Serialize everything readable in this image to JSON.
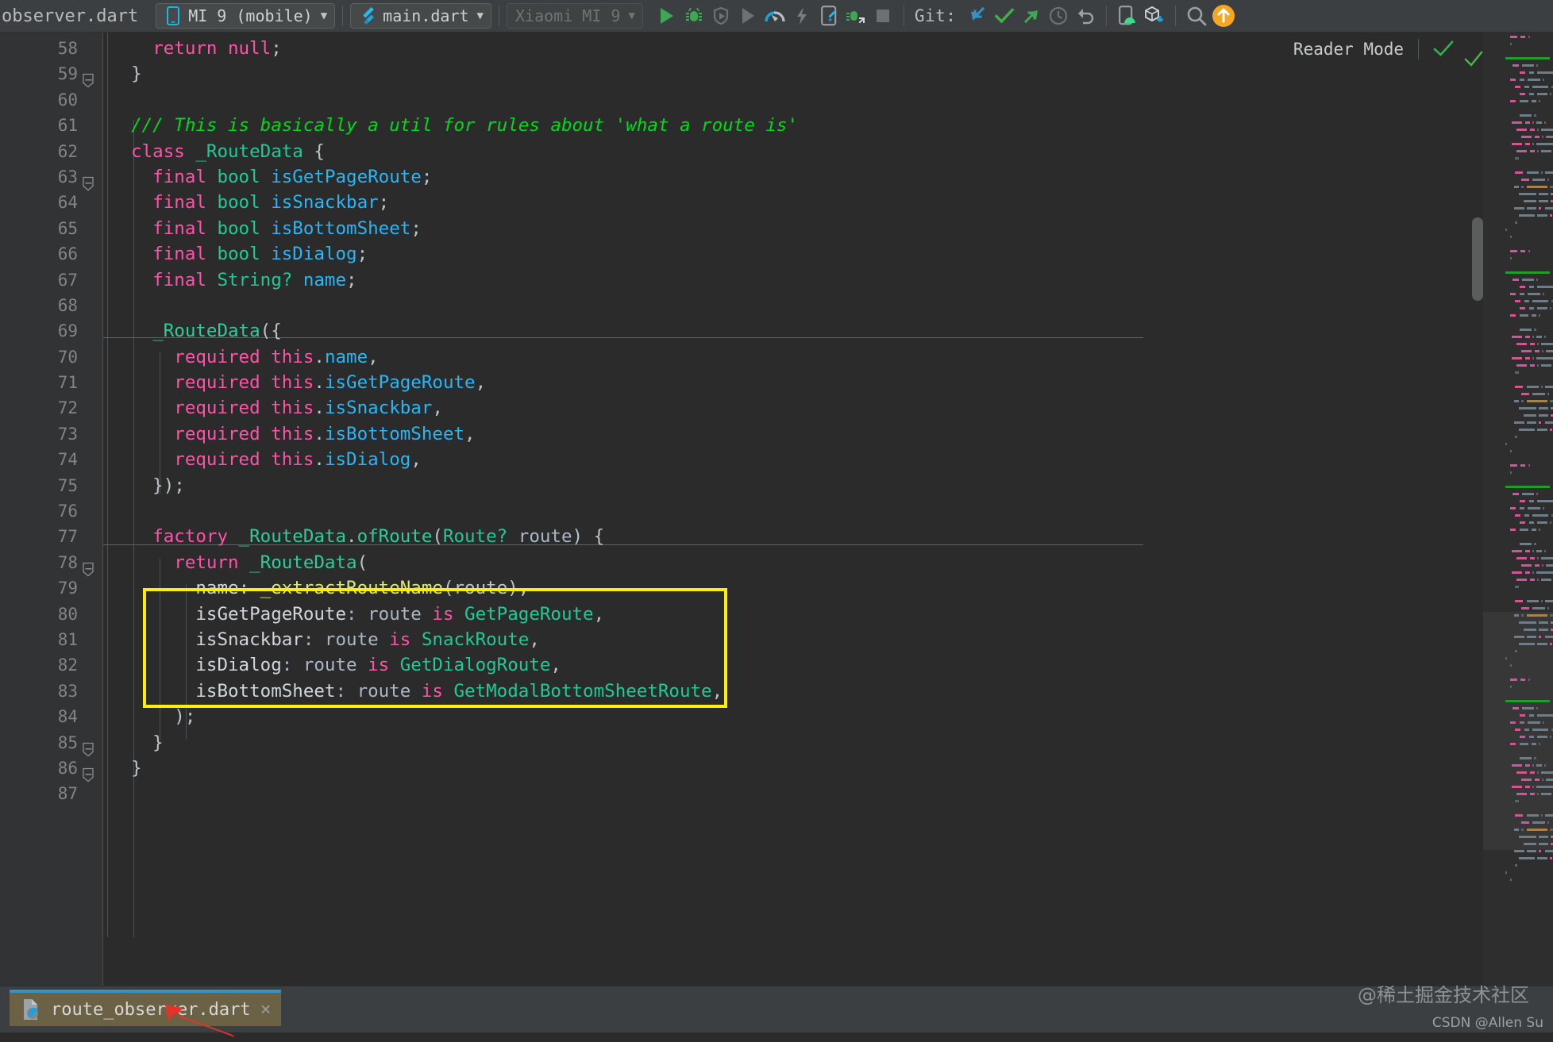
{
  "toolbar": {
    "filename": "observer.dart",
    "device_selector": {
      "label": "MI 9 (mobile)",
      "icon": "phone-icon",
      "caret": "▼"
    },
    "run_config": {
      "label": "main.dart",
      "icon": "flutter-icon",
      "caret": "▼"
    },
    "target_device": {
      "label": "Xiaomi MI 9",
      "caret": "▼"
    },
    "git_label": "Git:",
    "actions": [
      {
        "name": "run-button",
        "icon": "play-icon",
        "color": "#3ea754"
      },
      {
        "name": "debug-button",
        "icon": "bug-icon",
        "color": "#3ea754"
      },
      {
        "name": "run-with-coverage-button",
        "icon": "shield-play-icon",
        "color": "#6e7174"
      },
      {
        "name": "profile-run-button",
        "icon": "play-outline-icon",
        "color": "#6e7174"
      },
      {
        "name": "flutter-performance-button",
        "icon": "speedometer-icon",
        "color": "#19a3d8"
      },
      {
        "name": "hot-reload-button",
        "icon": "lightning-icon",
        "color": "#787c7f"
      },
      {
        "name": "open-devtools-button",
        "icon": "device-flutter-icon",
        "color": "#9aa0a4"
      },
      {
        "name": "attach-debugger-button",
        "icon": "debug-attach-icon",
        "color": "#3ea754"
      },
      {
        "name": "stop-button",
        "icon": "stop-square-icon",
        "color": "#6e7174"
      },
      {
        "name": "git-update-project-button",
        "icon": "arrow-down-left-icon",
        "color": "#3592c4"
      },
      {
        "name": "git-commit-button",
        "icon": "check-icon",
        "color": "#42b047"
      },
      {
        "name": "git-push-button",
        "icon": "arrow-up-right-icon",
        "color": "#3ea754"
      },
      {
        "name": "git-history-button",
        "icon": "clock-icon",
        "color": "#6e7174"
      },
      {
        "name": "git-rollback-button",
        "icon": "undo-icon",
        "color": "#9aa0a4"
      },
      {
        "name": "avd-manager-button",
        "icon": "device-android-icon",
        "color": "#3ddc84"
      },
      {
        "name": "sdk-manager-button",
        "icon": "cube-download-icon",
        "color": "#1f9ed1"
      },
      {
        "name": "search-everywhere-button",
        "icon": "search-icon",
        "color": "#9aa0a4"
      },
      {
        "name": "notifications-button",
        "icon": "arrow-up-circle-icon",
        "color": "#f5a623"
      }
    ]
  },
  "reader_mode": {
    "label": "Reader Mode",
    "icon": "check-icon",
    "color": "#2eb34a"
  },
  "editor": {
    "first_line_number": 58,
    "lines": [
      {
        "n": 58,
        "tokens": [
          {
            "t": "    ",
            "c": "plain"
          },
          {
            "t": "return",
            "c": "k"
          },
          {
            "t": " ",
            "c": "plain"
          },
          {
            "t": "null",
            "c": "k"
          },
          {
            "t": ";",
            "c": "pn"
          }
        ]
      },
      {
        "n": 59,
        "tokens": [
          {
            "t": "  }",
            "c": "pn"
          }
        ]
      },
      {
        "n": 60,
        "tokens": []
      },
      {
        "n": 61,
        "tokens": [
          {
            "t": "  /// This is basically a util for rules about 'what a route is'",
            "c": "cm"
          }
        ]
      },
      {
        "n": 62,
        "tokens": [
          {
            "t": "  ",
            "c": "plain"
          },
          {
            "t": "class",
            "c": "k"
          },
          {
            "t": " ",
            "c": "plain"
          },
          {
            "t": "_RouteData",
            "c": "ty"
          },
          {
            "t": " {",
            "c": "pn"
          }
        ]
      },
      {
        "n": 63,
        "tokens": [
          {
            "t": "    ",
            "c": "plain"
          },
          {
            "t": "final",
            "c": "k"
          },
          {
            "t": " ",
            "c": "plain"
          },
          {
            "t": "bool",
            "c": "ty"
          },
          {
            "t": " ",
            "c": "plain"
          },
          {
            "t": "isGetPageRoute",
            "c": "id"
          },
          {
            "t": ";",
            "c": "pn"
          }
        ]
      },
      {
        "n": 64,
        "tokens": [
          {
            "t": "    ",
            "c": "plain"
          },
          {
            "t": "final",
            "c": "k"
          },
          {
            "t": " ",
            "c": "plain"
          },
          {
            "t": "bool",
            "c": "ty"
          },
          {
            "t": " ",
            "c": "plain"
          },
          {
            "t": "isSnackbar",
            "c": "id"
          },
          {
            "t": ";",
            "c": "pn"
          }
        ]
      },
      {
        "n": 65,
        "tokens": [
          {
            "t": "    ",
            "c": "plain"
          },
          {
            "t": "final",
            "c": "k"
          },
          {
            "t": " ",
            "c": "plain"
          },
          {
            "t": "bool",
            "c": "ty"
          },
          {
            "t": " ",
            "c": "plain"
          },
          {
            "t": "isBottomSheet",
            "c": "id"
          },
          {
            "t": ";",
            "c": "pn"
          }
        ]
      },
      {
        "n": 66,
        "tokens": [
          {
            "t": "    ",
            "c": "plain"
          },
          {
            "t": "final",
            "c": "k"
          },
          {
            "t": " ",
            "c": "plain"
          },
          {
            "t": "bool",
            "c": "ty"
          },
          {
            "t": " ",
            "c": "plain"
          },
          {
            "t": "isDialog",
            "c": "id"
          },
          {
            "t": ";",
            "c": "pn"
          }
        ]
      },
      {
        "n": 67,
        "tokens": [
          {
            "t": "    ",
            "c": "plain"
          },
          {
            "t": "final",
            "c": "k"
          },
          {
            "t": " ",
            "c": "plain"
          },
          {
            "t": "String?",
            "c": "ty"
          },
          {
            "t": " ",
            "c": "plain"
          },
          {
            "t": "name",
            "c": "id"
          },
          {
            "t": ";",
            "c": "pn"
          }
        ]
      },
      {
        "n": 68,
        "tokens": []
      },
      {
        "n": 69,
        "tokens": [
          {
            "t": "    ",
            "c": "plain"
          },
          {
            "t": "_RouteData",
            "c": "ty2"
          },
          {
            "t": "({",
            "c": "pn"
          }
        ]
      },
      {
        "n": 70,
        "tokens": [
          {
            "t": "      ",
            "c": "plain"
          },
          {
            "t": "required",
            "c": "k"
          },
          {
            "t": " ",
            "c": "plain"
          },
          {
            "t": "this",
            "c": "k"
          },
          {
            "t": ".",
            "c": "pn"
          },
          {
            "t": "name",
            "c": "id"
          },
          {
            "t": ",",
            "c": "pn"
          }
        ]
      },
      {
        "n": 71,
        "tokens": [
          {
            "t": "      ",
            "c": "plain"
          },
          {
            "t": "required",
            "c": "k"
          },
          {
            "t": " ",
            "c": "plain"
          },
          {
            "t": "this",
            "c": "k"
          },
          {
            "t": ".",
            "c": "pn"
          },
          {
            "t": "isGetPageRoute",
            "c": "id"
          },
          {
            "t": ",",
            "c": "pn"
          }
        ]
      },
      {
        "n": 72,
        "tokens": [
          {
            "t": "      ",
            "c": "plain"
          },
          {
            "t": "required",
            "c": "k"
          },
          {
            "t": " ",
            "c": "plain"
          },
          {
            "t": "this",
            "c": "k"
          },
          {
            "t": ".",
            "c": "pn"
          },
          {
            "t": "isSnackbar",
            "c": "id"
          },
          {
            "t": ",",
            "c": "pn"
          }
        ]
      },
      {
        "n": 73,
        "tokens": [
          {
            "t": "      ",
            "c": "plain"
          },
          {
            "t": "required",
            "c": "k"
          },
          {
            "t": " ",
            "c": "plain"
          },
          {
            "t": "this",
            "c": "k"
          },
          {
            "t": ".",
            "c": "pn"
          },
          {
            "t": "isBottomSheet",
            "c": "id"
          },
          {
            "t": ",",
            "c": "pn"
          }
        ]
      },
      {
        "n": 74,
        "tokens": [
          {
            "t": "      ",
            "c": "plain"
          },
          {
            "t": "required",
            "c": "k"
          },
          {
            "t": " ",
            "c": "plain"
          },
          {
            "t": "this",
            "c": "k"
          },
          {
            "t": ".",
            "c": "pn"
          },
          {
            "t": "isDialog",
            "c": "id"
          },
          {
            "t": ",",
            "c": "pn"
          }
        ]
      },
      {
        "n": 75,
        "tokens": [
          {
            "t": "    });",
            "c": "pn"
          }
        ]
      },
      {
        "n": 76,
        "tokens": []
      },
      {
        "n": 77,
        "tokens": [
          {
            "t": "    ",
            "c": "plain"
          },
          {
            "t": "factory",
            "c": "k"
          },
          {
            "t": " ",
            "c": "plain"
          },
          {
            "t": "_RouteData",
            "c": "ty2"
          },
          {
            "t": ".",
            "c": "pn"
          },
          {
            "t": "ofRoute",
            "c": "ty2"
          },
          {
            "t": "(",
            "c": "pn"
          },
          {
            "t": "Route?",
            "c": "ty"
          },
          {
            "t": " route",
            "c": "plain"
          },
          {
            "t": ") {",
            "c": "pn"
          }
        ]
      },
      {
        "n": 78,
        "tokens": [
          {
            "t": "      ",
            "c": "plain"
          },
          {
            "t": "return",
            "c": "k"
          },
          {
            "t": " ",
            "c": "plain"
          },
          {
            "t": "_RouteData",
            "c": "ty2"
          },
          {
            "t": "(",
            "c": "pn"
          }
        ]
      },
      {
        "n": 79,
        "tokens": [
          {
            "t": "        ",
            "c": "plain"
          },
          {
            "t": "name",
            "c": "nm"
          },
          {
            "t": ": ",
            "c": "pn"
          },
          {
            "t": "_extractRouteName",
            "c": "fn"
          },
          {
            "t": "(route),",
            "c": "pn"
          }
        ]
      },
      {
        "n": 80,
        "tokens": [
          {
            "t": "        ",
            "c": "plain"
          },
          {
            "t": "isGetPageRoute",
            "c": "nm"
          },
          {
            "t": ": route ",
            "c": "plain"
          },
          {
            "t": "is",
            "c": "k"
          },
          {
            "t": " ",
            "c": "plain"
          },
          {
            "t": "GetPageRoute",
            "c": "ty"
          },
          {
            "t": ",",
            "c": "pn"
          }
        ]
      },
      {
        "n": 81,
        "tokens": [
          {
            "t": "        ",
            "c": "plain"
          },
          {
            "t": "isSnackbar",
            "c": "nm"
          },
          {
            "t": ": route ",
            "c": "plain"
          },
          {
            "t": "is",
            "c": "k"
          },
          {
            "t": " ",
            "c": "plain"
          },
          {
            "t": "SnackRoute",
            "c": "ty"
          },
          {
            "t": ",",
            "c": "pn"
          }
        ]
      },
      {
        "n": 82,
        "tokens": [
          {
            "t": "        ",
            "c": "plain"
          },
          {
            "t": "isDialog",
            "c": "nm"
          },
          {
            "t": ": route ",
            "c": "plain"
          },
          {
            "t": "is",
            "c": "k"
          },
          {
            "t": " ",
            "c": "plain"
          },
          {
            "t": "GetDialogRoute",
            "c": "ty"
          },
          {
            "t": ",",
            "c": "pn"
          }
        ]
      },
      {
        "n": 83,
        "tokens": [
          {
            "t": "        ",
            "c": "plain"
          },
          {
            "t": "isBottomSheet",
            "c": "nm"
          },
          {
            "t": ": route ",
            "c": "plain"
          },
          {
            "t": "is",
            "c": "k"
          },
          {
            "t": " ",
            "c": "plain"
          },
          {
            "t": "GetModalBottomSheetRoute",
            "c": "ty"
          },
          {
            "t": ",",
            "c": "pn"
          }
        ]
      },
      {
        "n": 84,
        "tokens": [
          {
            "t": "      );",
            "c": "pn"
          }
        ]
      },
      {
        "n": 85,
        "tokens": [
          {
            "t": "    }",
            "c": "pn"
          }
        ]
      },
      {
        "n": 86,
        "tokens": [
          {
            "t": "  }",
            "c": "pn"
          }
        ]
      },
      {
        "n": 87,
        "tokens": []
      }
    ]
  },
  "bottom_tab": {
    "label": "route_observer.dart",
    "close_icon": "×",
    "file_icon": "dart-file-icon",
    "active_border_color": "#3592c4",
    "background_color": "#6b6144"
  },
  "annotations": {
    "highlight_box_color": "#ffee00",
    "arrow_color": "#e8312a"
  },
  "watermarks": {
    "primary": "@稀土掘金技术社区",
    "secondary": "CSDN @Allen Su"
  }
}
